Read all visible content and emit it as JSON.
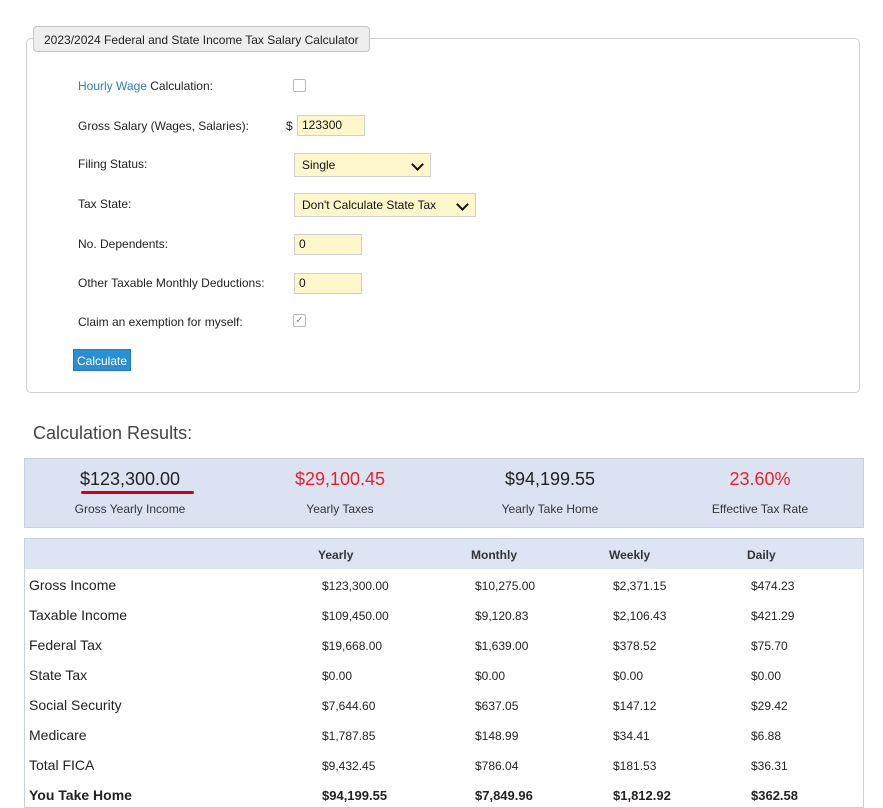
{
  "form": {
    "legend": "2023/2024 Federal and State Income Tax Salary Calculator",
    "hourly_link": "Hourly Wage",
    "hourly_suffix": " Calculation:",
    "gross_label": "Gross Salary (Wages, Salaries):",
    "currency_symbol": "$",
    "gross_value": "123300",
    "filing_label": "Filing Status:",
    "filing_value": "Single",
    "state_label": "Tax State:",
    "state_value": "Don't Calculate State Tax",
    "dependents_label": "No. Dependents:",
    "dependents_value": "0",
    "other_label": "Other Taxable Monthly Deductions:",
    "other_value": "0",
    "exemption_label": "Claim an exemption for myself:",
    "exemption_checked": true,
    "hourly_checked": false,
    "calculate_label": "Calculate"
  },
  "results": {
    "title": "Calculation Results:",
    "summary": [
      {
        "value": "$123,300.00",
        "label": "Gross Yearly Income",
        "color": "#222222"
      },
      {
        "value": "$29,100.45",
        "label": "Yearly Taxes",
        "color": "#e8202a"
      },
      {
        "value": "$94,199.55",
        "label": "Yearly Take Home",
        "color": "#222222"
      },
      {
        "value": "23.60%",
        "label": "Effective Tax Rate",
        "color": "#e8202a"
      }
    ],
    "annotation_color": "#d0001c"
  },
  "table": {
    "headers": [
      "",
      "Yearly",
      "Monthly",
      "Weekly",
      "Daily"
    ],
    "rows": [
      {
        "label": "Gross Income",
        "yearly": "$123,300.00",
        "monthly": "$10,275.00",
        "weekly": "$2,371.15",
        "daily": "$474.23"
      },
      {
        "label": "Taxable Income",
        "yearly": "$109,450.00",
        "monthly": "$9,120.83",
        "weekly": "$2,106.43",
        "daily": "$421.29"
      },
      {
        "label": "Federal Tax",
        "yearly": "$19,668.00",
        "monthly": "$1,639.00",
        "weekly": "$378.52",
        "daily": "$75.70"
      },
      {
        "label": "State Tax",
        "yearly": "$0.00",
        "monthly": "$0.00",
        "weekly": "$0.00",
        "daily": "$0.00"
      },
      {
        "label": "Social Security",
        "yearly": "$7,644.60",
        "monthly": "$637.05",
        "weekly": "$147.12",
        "daily": "$29.42"
      },
      {
        "label": "Medicare",
        "yearly": "$1,787.85",
        "monthly": "$148.99",
        "weekly": "$34.41",
        "daily": "$6.88"
      },
      {
        "label": "Total FICA",
        "yearly": "$9,432.45",
        "monthly": "$786.04",
        "weekly": "$181.53",
        "daily": "$36.31"
      },
      {
        "label": "You Take Home",
        "yearly": "$94,199.55",
        "monthly": "$7,849.96",
        "weekly": "$1,812.92",
        "daily": "$362.58"
      }
    ]
  }
}
